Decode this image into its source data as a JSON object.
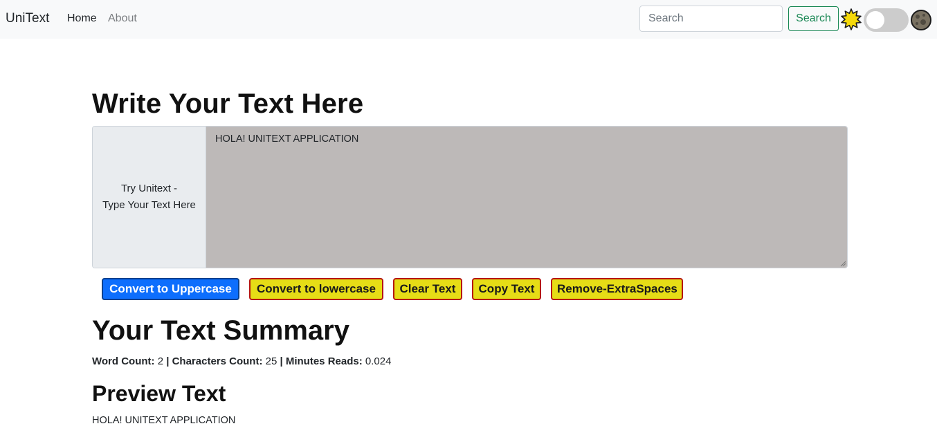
{
  "navbar": {
    "brand": "UniText",
    "links": [
      "Home",
      "About"
    ],
    "search": {
      "placeholder": "Search",
      "value": ""
    },
    "search_button": "Search",
    "mode_toggle": {
      "on": false
    }
  },
  "editor": {
    "heading": "Write Your Text Here",
    "prefix_line1": "Try Unitext -",
    "prefix_line2": "Type Your Text Here",
    "text": "HOLA! UNITEXT APPLICATION"
  },
  "actions": {
    "uppercase": "Convert to Uppercase",
    "lowercase": "Convert to lowercase",
    "clear": "Clear Text",
    "copy": "Copy Text",
    "remove_spaces": "Remove-ExtraSpaces"
  },
  "summary": {
    "heading": "Your Text Summary",
    "word_count_label": "Word Count:",
    "word_count": "2",
    "chars_label": "Characters Count:",
    "chars": "25",
    "minutes_label": "Minutes Reads:",
    "minutes": "0.024",
    "separator": "|"
  },
  "preview": {
    "heading": "Preview Text",
    "text": "HOLA! UNITEXT APPLICATION"
  },
  "colors": {
    "primary": "#0d6efd",
    "highlight_yellow": "#e6dd16",
    "border_red": "#b51414",
    "success": "#198754",
    "textarea_bg": "#bdb9b8"
  }
}
